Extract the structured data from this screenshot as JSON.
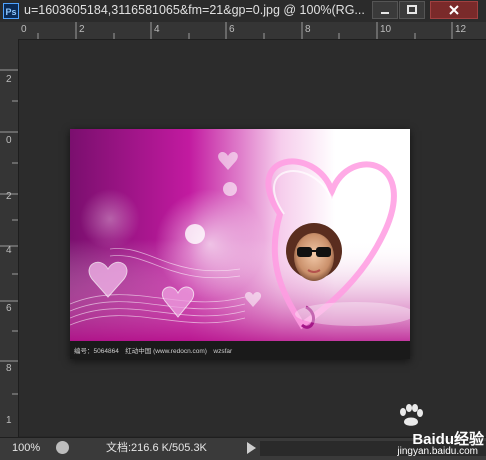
{
  "window": {
    "app_badge": "Ps",
    "title": "u=1603605184,3116581065&fm=21&gp=0.jpg @ 100%(RG..."
  },
  "ruler": {
    "h_labels": [
      "0",
      "2",
      "4",
      "6",
      "8",
      "10",
      "12"
    ],
    "v_labels": [
      "2",
      "0",
      "2",
      "4",
      "6",
      "8",
      "1"
    ]
  },
  "image": {
    "caption": "编号：5064864　红动中国 (www.redocn.com)　wzsfar"
  },
  "status": {
    "zoom": "100%",
    "doc_info": "文档:216.6 K/505.3K"
  },
  "watermark": {
    "brand": "Baidu经验",
    "url": "jingyan.baidu.com"
  },
  "icons": [
    "photoshop-icon",
    "minimize-icon",
    "maximize-icon",
    "close-icon",
    "status-icon",
    "play-icon",
    "baidu-paw-icon"
  ]
}
